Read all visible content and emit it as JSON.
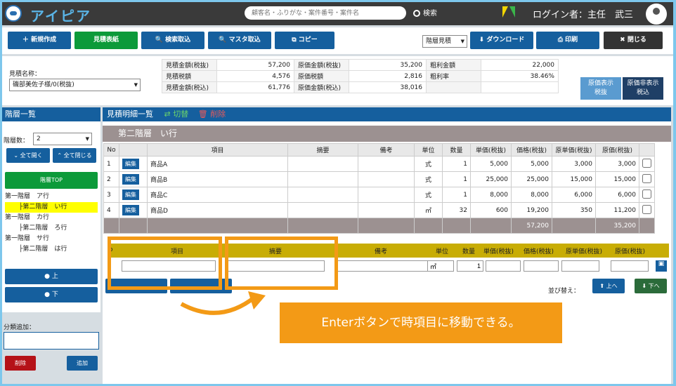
{
  "header": {
    "app_title": "アイピア",
    "search_placeholder": "顧客名・ふりがな・案件番号・案件名",
    "search_button": "検索",
    "login_text": "ログイン者：主任　武三"
  },
  "toolbar": {
    "new": "新規作成",
    "sheet": "見積表紙",
    "search_import": "検索取込",
    "master_import": "マスタ取込",
    "copy": "コピー",
    "layer_select": "階層見積",
    "download": "ダウンロード",
    "print": "印刷",
    "close": "閉じる"
  },
  "summary": {
    "estimate_name_label": "見積名称：",
    "estimate_name_value": "磯部美佐子様/0(税抜)",
    "rows": [
      [
        "見積金額(税抜)",
        "57,200",
        "原価金額(税抜)",
        "35,200",
        "粗利金額",
        "22,000"
      ],
      [
        "見積税額",
        "4,576",
        "原価税額",
        "2,816",
        "粗利率",
        "38.46%"
      ],
      [
        "見積金額(税込)",
        "61,776",
        "原価金額(税込)",
        "38,016",
        "",
        ""
      ]
    ],
    "show_cost": "原価表示\n税抜",
    "hide_cost": "原価非表示\n税込"
  },
  "sidebar": {
    "title": "階層一覧",
    "count_label": "階層数：",
    "count_value": "2",
    "open_all": "全て開く",
    "close_all": "全て閉じる",
    "top": "階層TOP",
    "items": [
      "第一階層　ア行",
      "├第二階層　い行",
      "第一階層　カ行",
      "├第二階層　ろ行",
      "第一階層　サ行",
      "├第二階層　は行"
    ],
    "up": "上",
    "down": "下",
    "add_label": "分類追加：",
    "delete": "削除",
    "add": "追加"
  },
  "main": {
    "title": "見積明細一覧",
    "switch": "切替",
    "delete": "削除",
    "section": "第二階層　い行",
    "columns": [
      "No",
      "",
      "項目",
      "摘要",
      "備考",
      "単位",
      "数量",
      "単価(税抜)",
      "価格(税抜)",
      "原単価(税抜)",
      "原価(税抜)",
      ""
    ],
    "rows": [
      [
        "1",
        "編集",
        "商品A",
        "",
        "",
        "式",
        "1",
        "5,000",
        "5,000",
        "3,000",
        "3,000"
      ],
      [
        "2",
        "編集",
        "商品B",
        "",
        "",
        "式",
        "1",
        "25,000",
        "25,000",
        "15,000",
        "15,000"
      ],
      [
        "3",
        "編集",
        "商品C",
        "",
        "",
        "式",
        "1",
        "8,000",
        "8,000",
        "6,000",
        "6,000"
      ],
      [
        "4",
        "編集",
        "商品D",
        "",
        "",
        "㎡",
        "32",
        "600",
        "19,200",
        "350",
        "11,200"
      ]
    ],
    "totals": {
      "price": "57,200",
      "cost": "35,200"
    },
    "input_columns": [
      "o",
      "項目",
      "摘要",
      "備考",
      "単位",
      "数量",
      "単価(税抜)",
      "価格(税抜)",
      "原単価(税抜)",
      "原価(税抜)"
    ],
    "input_unit": "㎡",
    "input_qty": "1",
    "sort_label": "並び替え：",
    "sort_up": "上へ",
    "sort_down": "下へ"
  },
  "callout": "Enterボタンで時項目に移動できる。"
}
